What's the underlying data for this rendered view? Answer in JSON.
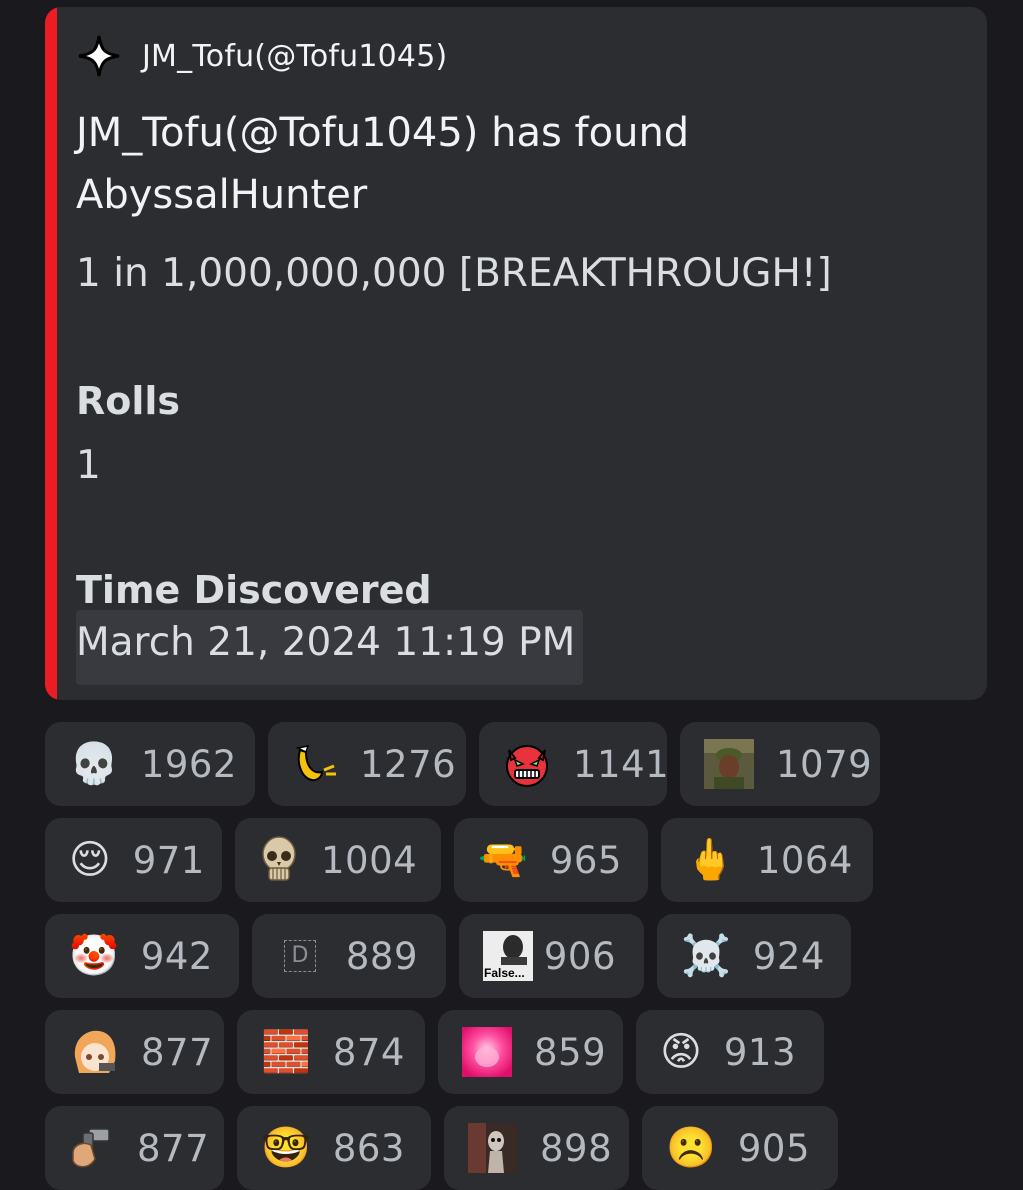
{
  "embed": {
    "accent_color": "#ec1c24",
    "author": {
      "icon": "sparkle-icon",
      "name": "JM_Tofu(@Tofu1045)"
    },
    "title": "JM_Tofu(@Tofu1045) has found AbyssalHunter",
    "description": "1 in 1,000,000,000 [BREAKTHROUGH!]",
    "fields": [
      {
        "name": "Rolls",
        "value": "1"
      },
      {
        "name": "Time Discovered",
        "value": "March 21, 2024 11:19 PM"
      }
    ]
  },
  "reactions": [
    [
      {
        "emoji": "💀",
        "icon": "skull-icon",
        "count": "1962"
      },
      {
        "emoji": "",
        "icon": "banana-custom-emoji-icon",
        "count": "1276"
      },
      {
        "emoji": "",
        "icon": "demon-face-custom-emoji-icon",
        "count": "1141"
      },
      {
        "emoji": "",
        "icon": "soldier-photo-custom-emoji-icon",
        "count": "1079"
      }
    ],
    [
      {
        "emoji": "😌",
        "icon": "relieved-face-icon",
        "count": "971"
      },
      {
        "emoji": "",
        "icon": "realistic-skull-custom-emoji-icon",
        "count": "1004"
      },
      {
        "emoji": "🔫",
        "icon": "water-pistol-icon",
        "count": "965"
      },
      {
        "emoji": "🖕",
        "icon": "middle-finger-icon",
        "count": "1064"
      }
    ],
    [
      {
        "emoji": "🤡",
        "icon": "clown-face-icon",
        "count": "942"
      },
      {
        "emoji": "D",
        "icon": "placeholder-emoji-icon",
        "count": "889"
      },
      {
        "emoji": "False...",
        "icon": "false-meme-custom-emoji-icon",
        "count": "906"
      },
      {
        "emoji": "☠️",
        "icon": "skull-crossbones-icon",
        "count": "924"
      }
    ],
    [
      {
        "emoji": "",
        "icon": "anime-girl-custom-emoji-icon",
        "count": "877"
      },
      {
        "emoji": "🧱",
        "icon": "bricks-icon",
        "count": "874"
      },
      {
        "emoji": "",
        "icon": "pink-glow-custom-emoji-icon",
        "count": "859"
      },
      {
        "emoji": "😡",
        "icon": "angry-face-icon",
        "count": "913"
      }
    ],
    [
      {
        "emoji": "",
        "icon": "gun-hand-custom-emoji-icon",
        "count": "877"
      },
      {
        "emoji": "🤓",
        "icon": "nerd-face-icon",
        "count": "863"
      },
      {
        "emoji": "",
        "icon": "alien-photo-custom-emoji-icon",
        "count": "898"
      },
      {
        "emoji": "☹️",
        "icon": "frowning-face-icon",
        "count": "905"
      }
    ]
  ]
}
